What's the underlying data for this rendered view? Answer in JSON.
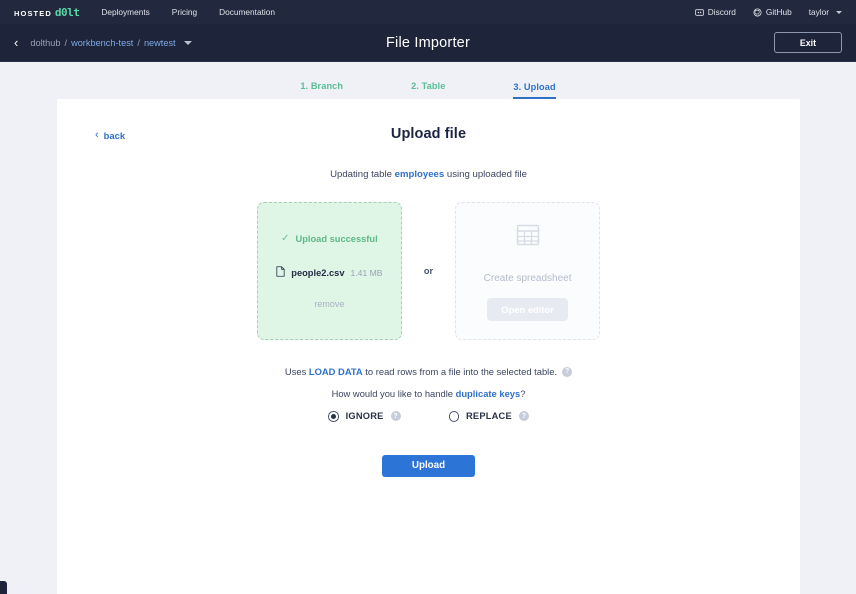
{
  "topnav": {
    "logo_hosted": "HOSTED",
    "logo_dolt": "d0lt",
    "links": [
      {
        "label": "Deployments"
      },
      {
        "label": "Pricing"
      },
      {
        "label": "Documentation"
      }
    ],
    "right": [
      {
        "label": "Discord",
        "icon": "discord-icon"
      },
      {
        "label": "GitHub",
        "icon": "github-icon"
      }
    ],
    "user": "taylor"
  },
  "subheader": {
    "title": "File Importer",
    "exit_label": "Exit",
    "breadcrumb": {
      "owner": "dolthub",
      "sep1": "/",
      "repo": "workbench-test",
      "sep2": "/",
      "branch": "newtest"
    }
  },
  "steps": [
    {
      "label": "1. Branch",
      "state": "done"
    },
    {
      "label": "2. Table",
      "state": "done"
    },
    {
      "label": "3. Upload",
      "state": "active"
    }
  ],
  "main": {
    "back_label": "back",
    "title": "Upload file",
    "updating_prefix": "Updating table ",
    "updating_table": "employees",
    "updating_suffix": " using uploaded file",
    "or_label": "or",
    "upload_card": {
      "status": "Upload successful",
      "file_name": "people2.csv",
      "file_size": "1.41 MB",
      "remove_label": "remove"
    },
    "spreadsheet_card": {
      "label": "Create spreadsheet",
      "button_label": "Open editor"
    },
    "options": {
      "load_prefix": "Uses ",
      "load_keyword": "LOAD DATA",
      "load_suffix": " to read rows from a file into the selected table.",
      "dupe_prefix": "How would you like to handle ",
      "dupe_keyword": "duplicate keys",
      "dupe_suffix": "?",
      "ignore_label": "IGNORE",
      "replace_label": "REPLACE",
      "selected": "IGNORE",
      "help_glyph": "?"
    },
    "submit_label": "Upload"
  },
  "colors": {
    "nav_bg": "#22283d",
    "subnav_bg": "#1e2439",
    "page_bg": "#eff1f6",
    "accent_blue": "#2f71c9",
    "button_blue": "#2c74d6",
    "success_green": "#5fb887",
    "success_bg": "#dff5e6",
    "brand_green": "#5bd6a6"
  }
}
